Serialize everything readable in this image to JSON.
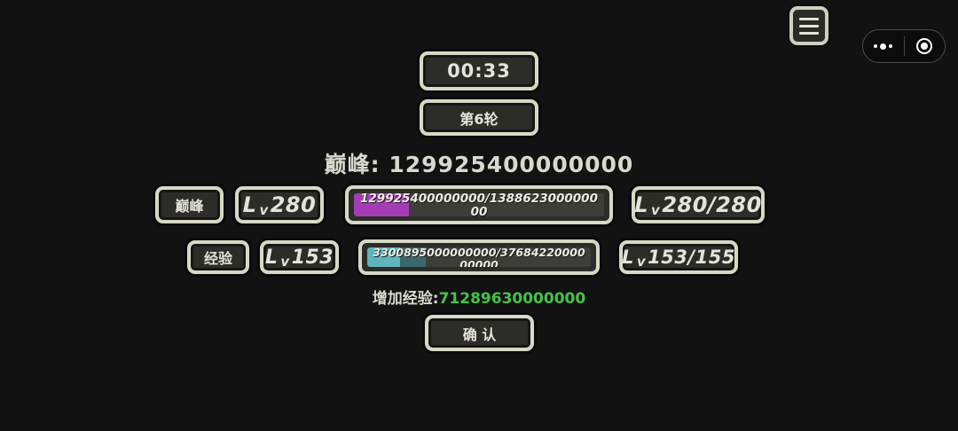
{
  "timer": {
    "value": "00:33"
  },
  "round": {
    "label": "第6轮"
  },
  "summit": {
    "label": "巅峰: ",
    "value": "129925400000000"
  },
  "row_summit": {
    "tag": "巅峰",
    "level_prefix": "L",
    "level_v": "v",
    "level_value": "280",
    "progress_text": "129925400000000/138862300000000",
    "progress_fraction": 0.22,
    "level_range": "280/280"
  },
  "row_exp": {
    "tag": "经验",
    "level_prefix": "L",
    "level_v": "v",
    "level_value": "153",
    "progress_text": "3300895000000000/3768422000000000",
    "progress_fraction_main": 0.145,
    "progress_fraction_secondary": 0.26,
    "level_range": "153/155"
  },
  "gain": {
    "label": "增加经验:",
    "value": "71289630000000",
    "value_color": "#46c24a"
  },
  "confirm": {
    "label": "确 认"
  },
  "colors": {
    "frame_border": "#d8d8c6",
    "frame_bg": "#2c2c28",
    "purple_fill": "#a63cb5",
    "cyan_fill": "#5fb4bd"
  },
  "icons": {
    "menu": "menu-icon",
    "more": "more-dots-icon",
    "close": "target-icon"
  }
}
